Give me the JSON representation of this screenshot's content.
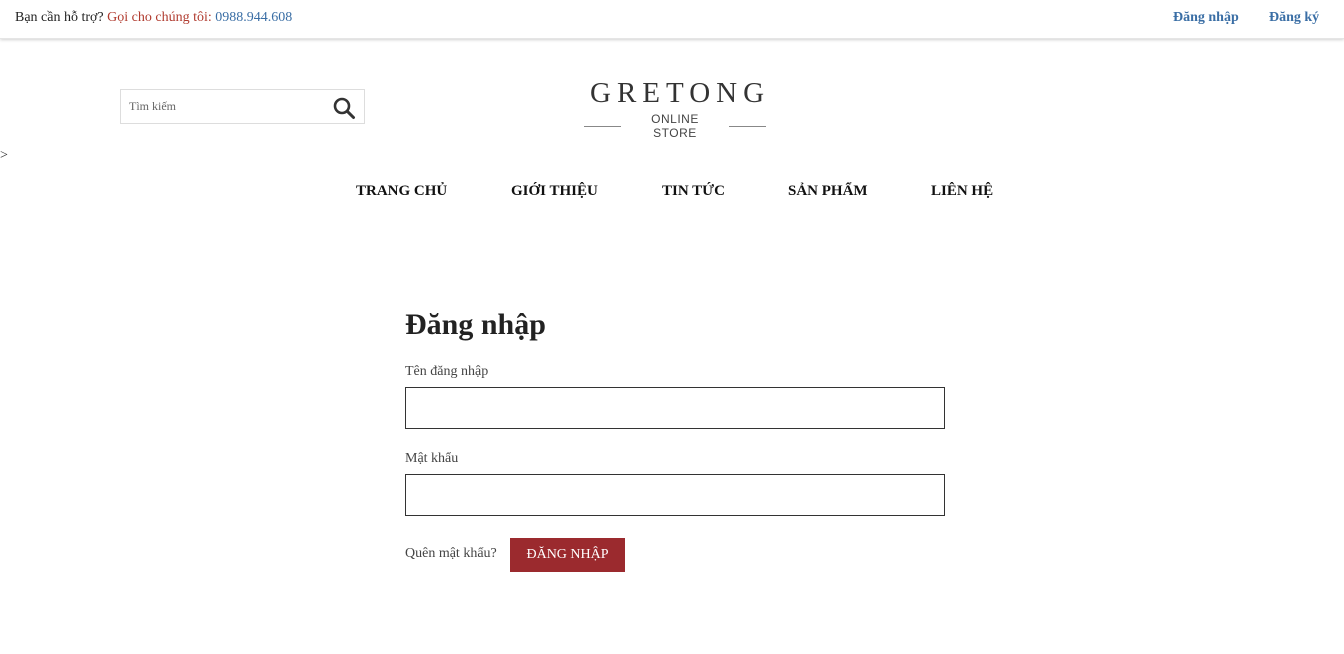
{
  "topbar": {
    "support_text": "Bạn cần hỗ trợ? ",
    "call_text": "Gọi cho chúng tôi: ",
    "phone": "0988.944.608",
    "login_link": "Đăng nhập",
    "register_link": "Đăng ký"
  },
  "search": {
    "placeholder": "Tìm kiếm",
    "icon": "search-icon"
  },
  "logo": {
    "brand": "GRETONG",
    "subtitle": "ONLINE STORE"
  },
  "stray_text": ">",
  "nav": {
    "items": [
      "TRANG CHỦ",
      "GIỚI THIỆU",
      "TIN TỨC",
      "SẢN PHẨM",
      "LIÊN HỆ"
    ]
  },
  "login": {
    "title": "Đăng nhập",
    "username_label": "Tên đăng nhập",
    "username_value": "",
    "password_label": "Mật khẩu",
    "password_value": "",
    "forgot_link": "Quên mật khẩu?",
    "submit_label": "ĐĂNG NHẬP"
  },
  "colors": {
    "accent": "#9b2a2e",
    "link": "#3a6ea5",
    "call_red": "#b03a2e"
  }
}
